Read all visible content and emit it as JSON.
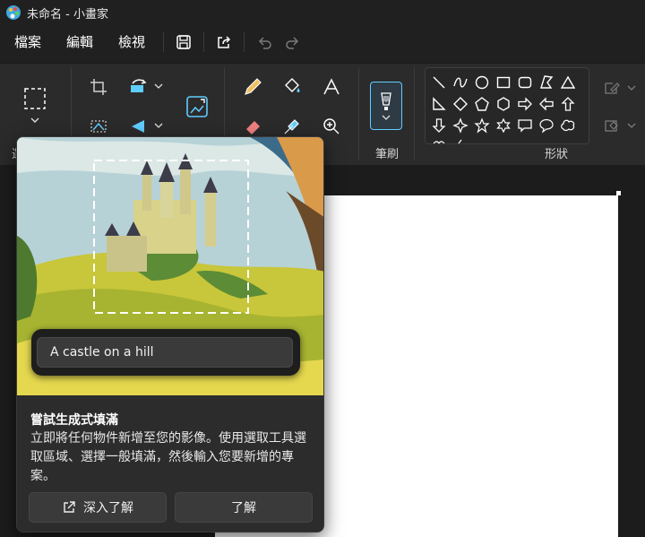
{
  "window": {
    "title": "未命名 - 小畫家"
  },
  "menu": {
    "file": "檔案",
    "edit": "編輯",
    "view": "檢視"
  },
  "toolbar": {
    "save_icon": "save-icon",
    "share_icon": "share-icon",
    "undo_icon": "undo-icon",
    "redo_icon": "redo-icon"
  },
  "ribbon": {
    "brushes_label": "筆刷",
    "shapes_label": "形狀",
    "selection_label_partial": "選"
  },
  "popup": {
    "prompt_value": "A castle on a hill",
    "title": "嘗試生成式填滿",
    "body": "立即將任何物件新增至您的影像。使用選取工具選取區域、選擇一般填滿，然後輸入您要新增的專案。",
    "learn_more": "深入了解",
    "got_it": "了解"
  },
  "colors": {
    "accent": "#60cdff",
    "background": "#202020",
    "ribbon": "#2b2b2b",
    "canvas": "#ffffff"
  }
}
